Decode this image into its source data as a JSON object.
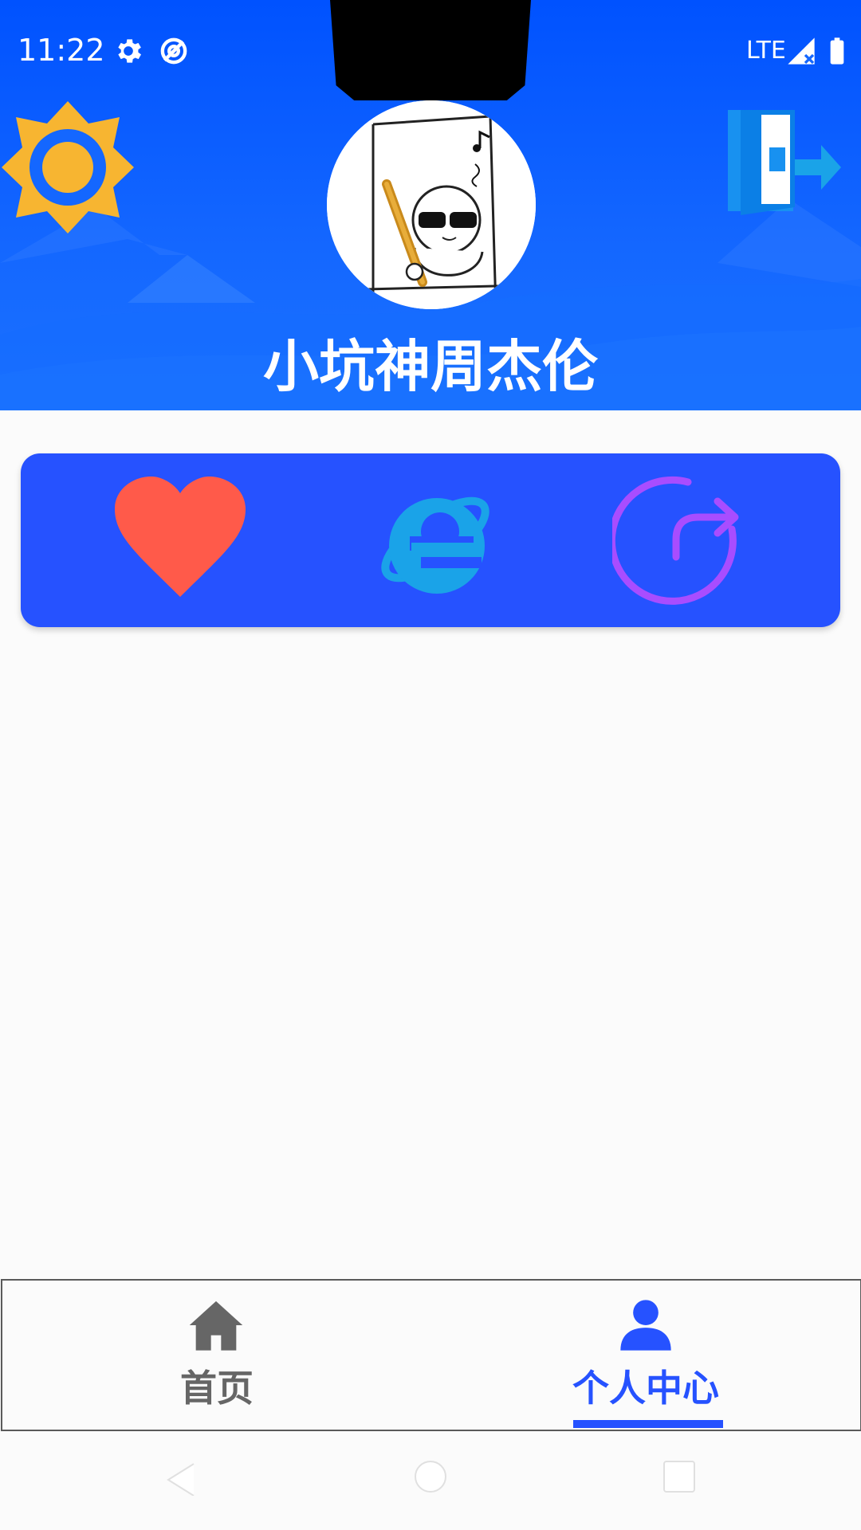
{
  "status_bar": {
    "time": "11:22",
    "network": "LTE",
    "icons": [
      "settings-icon",
      "sync-off-icon",
      "signal-icon",
      "battery-icon"
    ]
  },
  "header": {
    "username": "小坑神周杰伦",
    "left_icon": "sun-icon",
    "right_icon": "exit-door-icon",
    "avatar": "cartoon-avatar"
  },
  "actions": {
    "items": [
      "heart-icon",
      "internet-explorer-icon",
      "refresh-icon"
    ]
  },
  "bottom_nav": {
    "items": [
      {
        "label": "首页",
        "icon": "home-icon",
        "active": false
      },
      {
        "label": "个人中心",
        "icon": "person-icon",
        "active": true
      }
    ]
  },
  "colors": {
    "header_blue": "#0052ff",
    "card_blue": "#2652ff",
    "active_blue": "#2652ff",
    "inactive_gray": "#666666",
    "heart_red": "#ff5a4a",
    "ie_blue": "#1aa3e8",
    "refresh_purple": "#a84dff",
    "sun_yellow": "#f7b531"
  }
}
